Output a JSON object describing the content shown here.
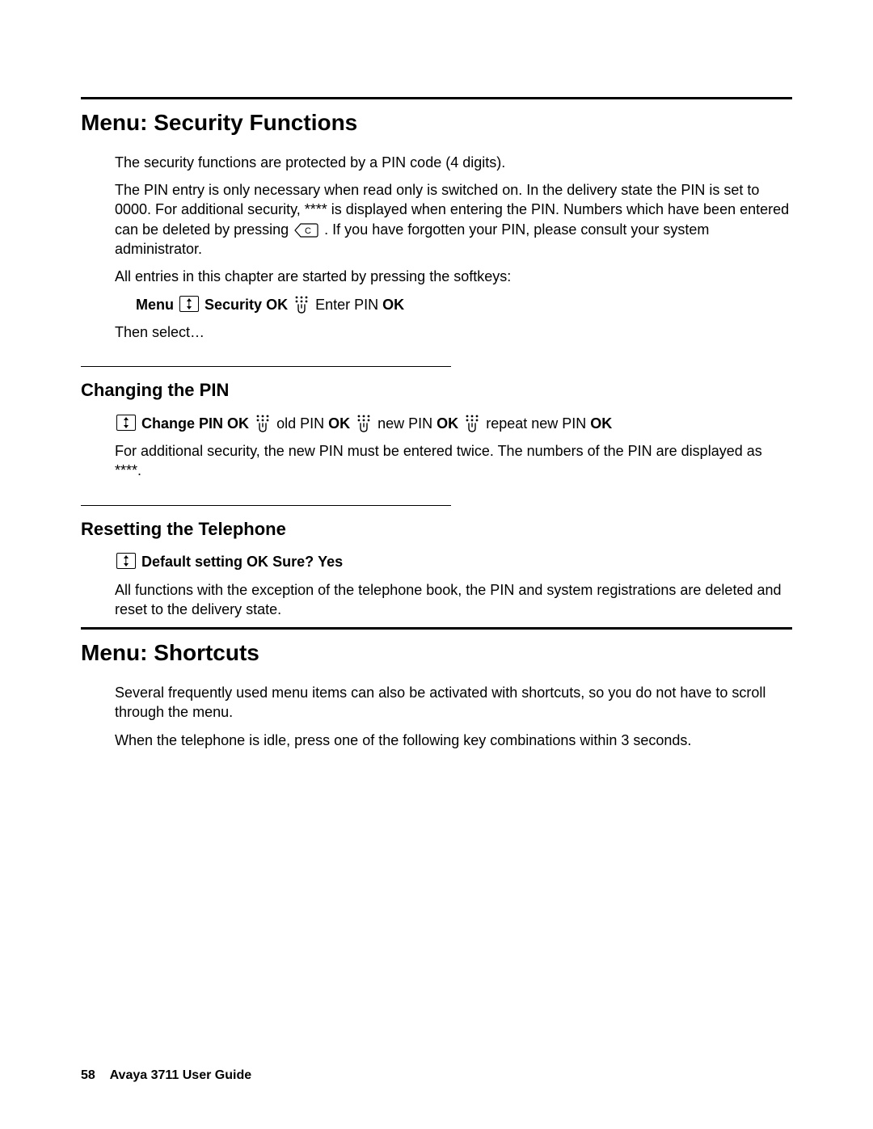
{
  "section1": {
    "heading": "Menu: Security Functions",
    "p1": "The security functions are protected by a PIN code (4 digits).",
    "p2a": "The PIN entry is only necessary when read only is switched on. In the delivery state the PIN is set to 0000. For additional security, **** is displayed when entering the PIN. Numbers which have been entered can be deleted by pressing ",
    "p2b": ". If you have forgotten your PIN, please consult your system administrator.",
    "p3": "All entries in this chapter are started by pressing the softkeys:",
    "seq": {
      "menu": "Menu",
      "security": "Security",
      "ok1": "OK",
      "enterpin": " Enter PIN ",
      "ok2": "OK"
    },
    "p4": "Then select…"
  },
  "sub1": {
    "heading": "Changing the PIN",
    "seq": {
      "changepin": "Change PIN",
      "ok1": "OK",
      "old": " old PIN ",
      "ok2": "OK",
      "new": " new PIN ",
      "ok3": "OK",
      "repeat": " repeat new PIN ",
      "ok4": "OK"
    },
    "p1": "For additional security, the new PIN must be entered twice. The numbers of the PIN are displayed as ****."
  },
  "sub2": {
    "heading": "Resetting the Telephone",
    "seq": {
      "default": "Default setting",
      "ok": "OK",
      "sure": "Sure?",
      "yes": "Yes"
    },
    "p1": "All functions with the exception of the telephone book, the PIN and system registrations are deleted and reset to the delivery state."
  },
  "section2": {
    "heading": "Menu: Shortcuts",
    "p1": "Several frequently used menu items can also be activated with shortcuts, so you do not have to scroll through the menu.",
    "p2": "When the telephone is idle, press one of the following key combinations within 3 seconds."
  },
  "footer": {
    "pagenum": "58",
    "title": "Avaya 3711 User Guide"
  }
}
